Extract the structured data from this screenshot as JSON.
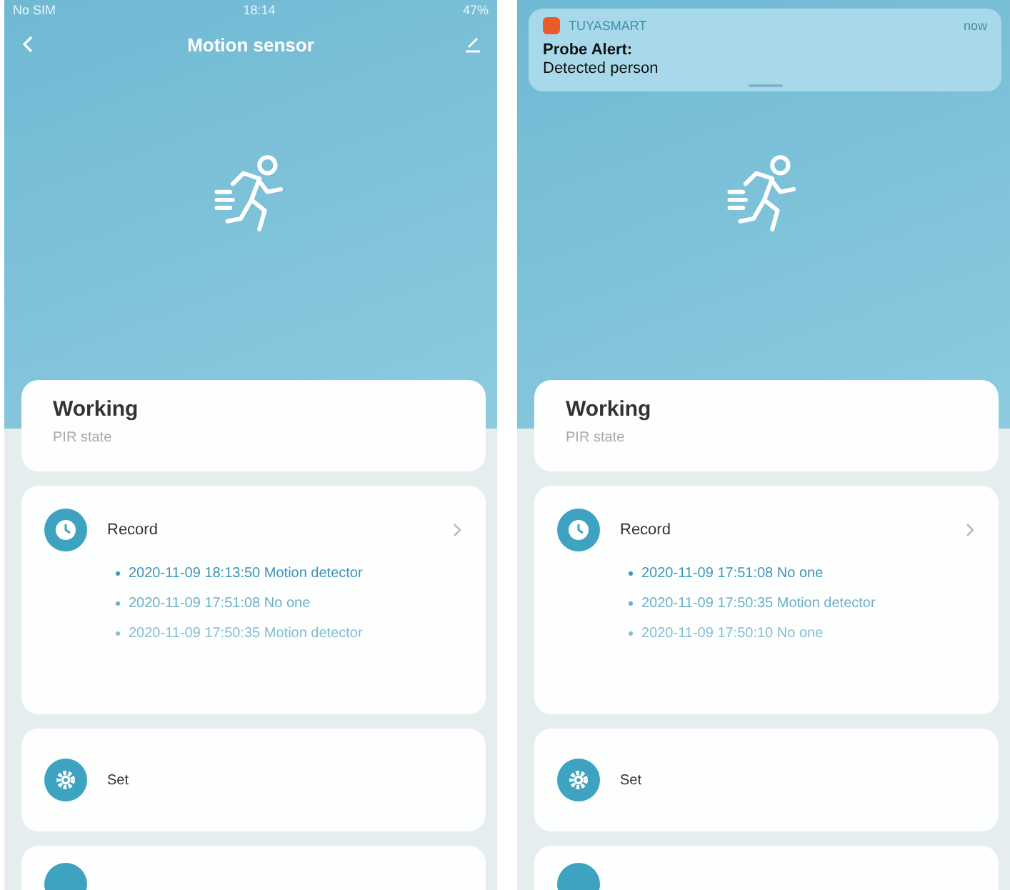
{
  "phones": [
    {
      "status_bar": {
        "carrier": "No SIM",
        "time": "18:14",
        "battery": "47%"
      },
      "nav": {
        "title": "Motion sensor"
      },
      "state": {
        "value": "Working",
        "label": "PIR state"
      },
      "record": {
        "title": "Record",
        "items": [
          "2020-11-09 18:13:50 Motion detector",
          "2020-11-09 17:51:08 No one",
          "2020-11-09 17:50:35 Motion detector"
        ]
      },
      "settings": {
        "title": "Set"
      }
    },
    {
      "notification": {
        "app": "TUYASMART",
        "time": "now",
        "title": "Probe Alert:",
        "body": "Detected person"
      },
      "state": {
        "value": "Working",
        "label": "PIR state"
      },
      "record": {
        "title": "Record",
        "items": [
          "2020-11-09 17:51:08 No one",
          "2020-11-09 17:50:35 Motion detector",
          "2020-11-09 17:50:10 No one"
        ]
      },
      "settings": {
        "title": "Set"
      }
    }
  ]
}
